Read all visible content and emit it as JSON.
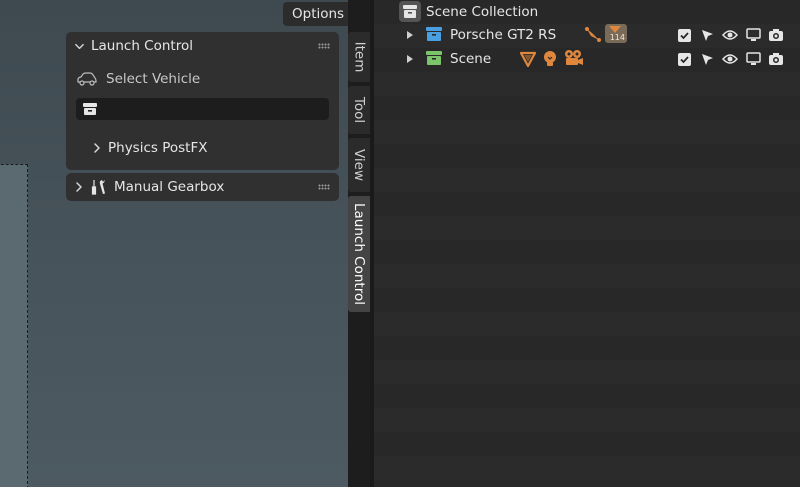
{
  "viewport": {
    "options_label": "Options"
  },
  "npanel": {
    "launch_control": {
      "title": "Launch Control",
      "select_vehicle_label": "Select Vehicle",
      "vehicle_field_value": "",
      "physics_postfx_label": "Physics PostFX"
    },
    "manual_gearbox": {
      "title": "Manual Gearbox"
    },
    "tabs": [
      "Item",
      "Tool",
      "View",
      "Launch Control"
    ],
    "active_tab": "Launch Control"
  },
  "outliner": {
    "root_label": "Scene Collection",
    "items": [
      {
        "label": "Porsche GT2 RS",
        "collection_color": "#4a9fe0",
        "child_badge_count": "114"
      },
      {
        "label": "Scene",
        "collection_color": "#7cc46a"
      }
    ]
  },
  "colors": {
    "viewport_bg": "#46525a",
    "panel_bg": "#303030",
    "outliner_bg": "#282828",
    "accent_orange": "#e0873e"
  }
}
